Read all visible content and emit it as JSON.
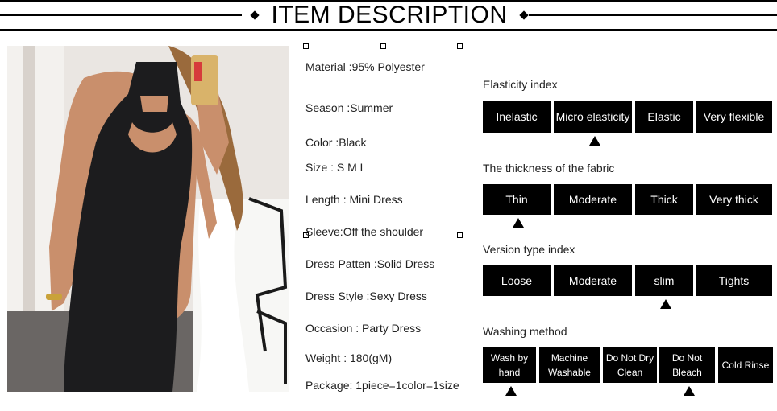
{
  "banner": {
    "title": "ITEM DESCRIPTION"
  },
  "attributes": [
    {
      "label": "Material :95% Polyester"
    },
    {
      "label": "Season :Summer"
    },
    {
      "label": "Color :Black"
    },
    {
      "label": "Size : S M L"
    },
    {
      "label": "Length : Mini Dress"
    },
    {
      "label": "Sleeve:Off the shoulder"
    },
    {
      "label": "Dress Patten :Solid Dress"
    },
    {
      "label": "Dress Style :Sexy Dress"
    },
    {
      "label": "Occasion : Party Dress"
    },
    {
      "label": "Weight : 180(gM)"
    },
    {
      "label": "Package: 1piece=1color=1size"
    }
  ],
  "elasticity": {
    "title": "Elasticity index",
    "options": [
      "Inelastic",
      "Micro elasticity",
      "Elastic",
      "Very flexible"
    ],
    "selected": "Micro elasticity"
  },
  "thickness": {
    "title": "The thickness of the fabric",
    "options": [
      "Thin",
      "Moderate",
      "Thick",
      "Very thick"
    ],
    "selected": "Thin"
  },
  "version": {
    "title": "Version type index",
    "options": [
      "Loose",
      "Moderate",
      "slim",
      "Tights"
    ],
    "selected": "slim"
  },
  "washing": {
    "title": "Washing method",
    "options": [
      "Wash by hand",
      "Machine Washable",
      "Do Not Dry Clean",
      "Do Not Bleach",
      "Cold Rinse"
    ],
    "selected": [
      "Wash by hand",
      "Do Not Bleach"
    ]
  },
  "colors": {
    "accent": "#000000",
    "background": "#ffffff",
    "text": "#222222"
  },
  "icons": {
    "selection_marker": "up-triangle-icon",
    "banner_ornament": "diamond-icon"
  }
}
